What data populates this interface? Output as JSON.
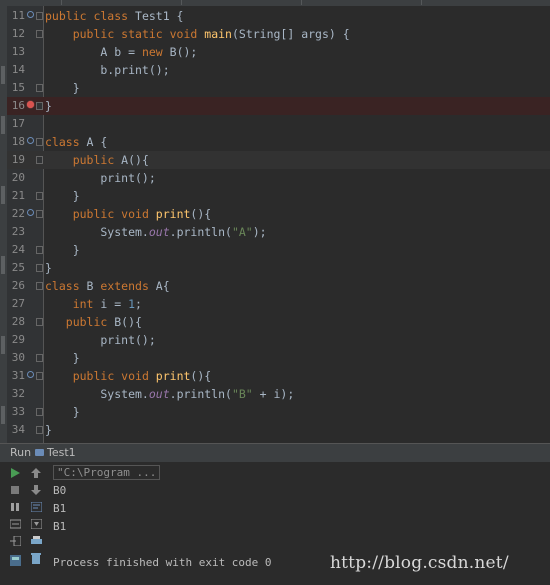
{
  "editor": {
    "lines": [
      {
        "n": "11",
        "code": [
          [
            "kw",
            "public class "
          ],
          [
            "",
            "Test1 {"
          ]
        ]
      },
      {
        "n": "12",
        "code": [
          [
            "",
            "    "
          ],
          [
            "kw",
            "public static void "
          ],
          [
            "fn",
            "main"
          ],
          [
            "",
            "(String[] args) {"
          ]
        ]
      },
      {
        "n": "13",
        "code": [
          [
            "",
            "        A b = "
          ],
          [
            "kw",
            "new "
          ],
          [
            "",
            "B();"
          ]
        ]
      },
      {
        "n": "14",
        "code": [
          [
            "",
            "        b.print();"
          ]
        ]
      },
      {
        "n": "15",
        "code": [
          [
            "",
            "    }"
          ]
        ]
      },
      {
        "n": "16",
        "code": [
          [
            "",
            "}"
          ]
        ]
      },
      {
        "n": "17",
        "code": []
      },
      {
        "n": "18",
        "code": [
          [
            "kw",
            "class "
          ],
          [
            "",
            "A {"
          ]
        ]
      },
      {
        "n": "19",
        "code": [
          [
            "",
            "    "
          ],
          [
            "kw",
            "public "
          ],
          [
            "",
            "A(){"
          ]
        ]
      },
      {
        "n": "20",
        "code": [
          [
            "",
            "        print();"
          ]
        ]
      },
      {
        "n": "21",
        "code": [
          [
            "",
            "    }"
          ]
        ]
      },
      {
        "n": "22",
        "code": [
          [
            "",
            "    "
          ],
          [
            "kw",
            "public void "
          ],
          [
            "fn",
            "print"
          ],
          [
            "",
            "(){"
          ]
        ]
      },
      {
        "n": "23",
        "code": [
          [
            "",
            "        System."
          ],
          [
            "st",
            "out"
          ],
          [
            "",
            ".println("
          ],
          [
            "str",
            "\"A\""
          ],
          [
            "",
            ");"
          ]
        ]
      },
      {
        "n": "24",
        "code": [
          [
            "",
            "    }"
          ]
        ]
      },
      {
        "n": "25",
        "code": [
          [
            "",
            "}"
          ]
        ]
      },
      {
        "n": "26",
        "code": [
          [
            "kw",
            "class "
          ],
          [
            "",
            "B "
          ],
          [
            "kw",
            "extends "
          ],
          [
            "",
            "A{"
          ]
        ]
      },
      {
        "n": "27",
        "code": [
          [
            "",
            "    "
          ],
          [
            "kw",
            "int "
          ],
          [
            "",
            "i = "
          ],
          [
            "num",
            "1"
          ],
          [
            "",
            ";"
          ]
        ]
      },
      {
        "n": "28",
        "code": [
          [
            "",
            "   "
          ],
          [
            "kw",
            "public "
          ],
          [
            "",
            "B(){"
          ]
        ]
      },
      {
        "n": "29",
        "code": [
          [
            "",
            "        print();"
          ]
        ]
      },
      {
        "n": "30",
        "code": [
          [
            "",
            "    }"
          ]
        ]
      },
      {
        "n": "31",
        "code": [
          [
            "",
            "    "
          ],
          [
            "kw",
            "public void "
          ],
          [
            "fn",
            "print"
          ],
          [
            "",
            "(){"
          ]
        ]
      },
      {
        "n": "32",
        "code": [
          [
            "",
            "        System."
          ],
          [
            "st",
            "out"
          ],
          [
            "",
            ".println("
          ],
          [
            "str",
            "\"B\""
          ],
          [
            "",
            " + i);"
          ]
        ]
      },
      {
        "n": "33",
        "code": [
          [
            "",
            "    }"
          ]
        ]
      },
      {
        "n": "34",
        "code": [
          [
            "",
            "}"
          ]
        ]
      }
    ]
  },
  "run_panel": {
    "label": "Run",
    "tab_label": "Test1",
    "command": "\"C:\\Program ...",
    "output": [
      "B0",
      "B1",
      "B1"
    ],
    "finish_message": "Process finished with exit code 0"
  },
  "watermark": "http://blog.csdn.net/",
  "colors": {
    "background": "#2b2b2b",
    "keyword": "#cc7832",
    "method": "#ffc66d",
    "string": "#6a8759",
    "static_field": "#9876aa",
    "number": "#6897bb",
    "breakpoint": "#d9534f"
  },
  "icons": [
    "run-icon",
    "stop-icon",
    "pause-icon",
    "dump-icon",
    "exit-icon",
    "layout-icon",
    "up-arrow-icon",
    "down-arrow-icon",
    "soft-wrap-icon",
    "scroll-end-icon",
    "print-icon",
    "trash-icon"
  ]
}
